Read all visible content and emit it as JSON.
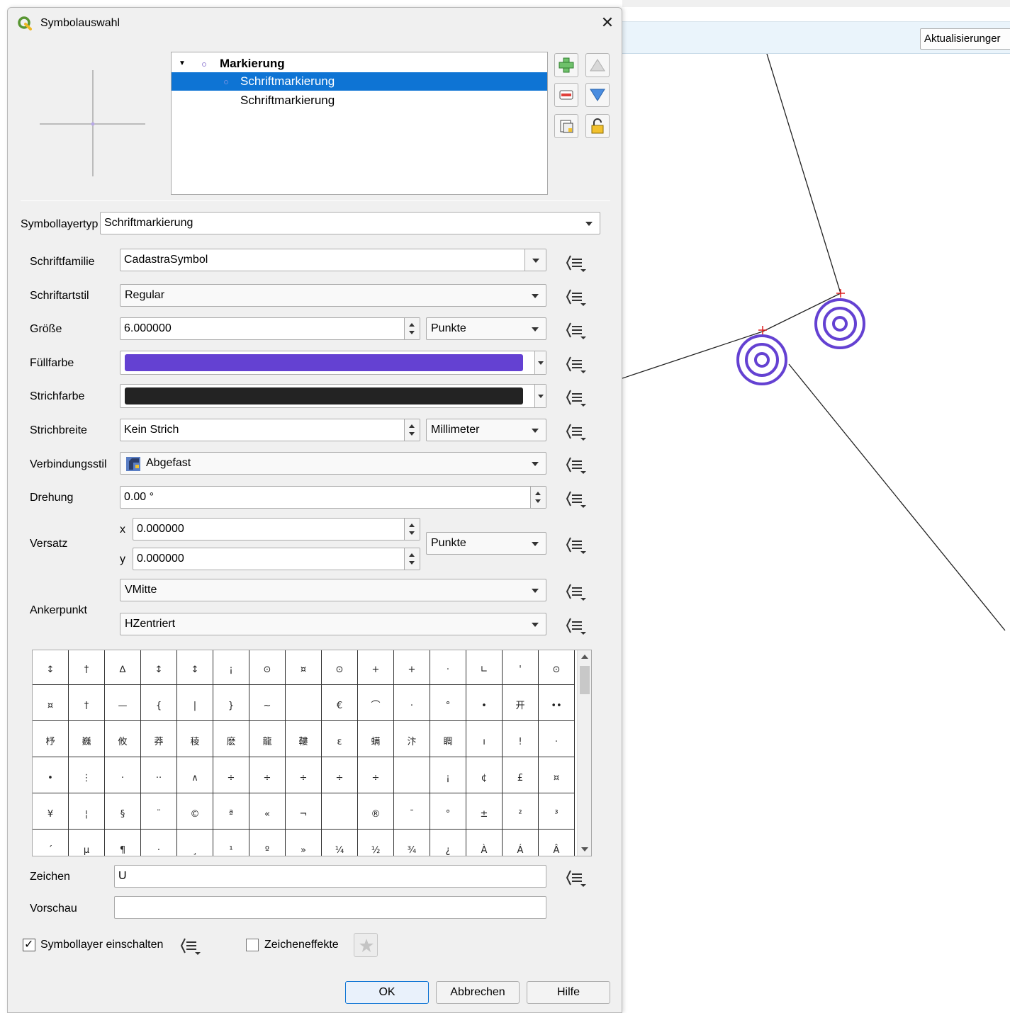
{
  "background": {
    "update_button_label": "Aktualisierunger"
  },
  "dialog": {
    "title": "Symbolauswahl",
    "close_glyph": "✕",
    "tree": {
      "root_label": "Markierung",
      "items": [
        "Schriftmarkierung",
        "Schriftmarkierung"
      ],
      "selected_index": 0
    },
    "symbol_layer_type": {
      "label": "Symbollayertyp",
      "value": "Schriftmarkierung"
    },
    "font_family": {
      "label": "Schriftfamilie",
      "value": "CadastraSymbol"
    },
    "font_style": {
      "label": "Schriftartstil",
      "value": "Regular"
    },
    "size": {
      "label": "Größe",
      "value": "6.000000",
      "unit": "Punkte"
    },
    "fill_color": {
      "label": "Füllfarbe",
      "color": "#6441d2"
    },
    "stroke_color": {
      "label": "Strichfarbe",
      "color": "#232323"
    },
    "stroke_width": {
      "label": "Strichbreite",
      "value": "Kein Strich",
      "unit": "Millimeter"
    },
    "join_style": {
      "label": "Verbindungsstil",
      "value": "Abgefast"
    },
    "rotation": {
      "label": "Drehung",
      "value": "0.00 °"
    },
    "offset": {
      "label": "Versatz",
      "x_label": "x",
      "x_value": "0.000000",
      "y_label": "y",
      "y_value": "0.000000",
      "unit": "Punkte"
    },
    "anchor": {
      "label": "Ankerpunkt",
      "vertical": "VMitte",
      "horizontal": "HZentriert"
    },
    "char_grid": {
      "rows": [
        [
          "↕",
          "†",
          "∆",
          "↕",
          "↕",
          "¡",
          "⊙",
          "¤",
          "⊙",
          "+",
          "+",
          "·",
          "∟",
          "'",
          "⊙"
        ],
        [
          "¤",
          "†",
          "—",
          "{",
          "|",
          "}",
          "~",
          "",
          "€",
          "⌒",
          "·",
          "°",
          "•",
          "开",
          "••"
        ],
        [
          "杼",
          "巍",
          "攸",
          "莽",
          "稜",
          "麽",
          "龍",
          "鞻",
          "ɛ",
          "螨",
          "汴",
          "睭",
          "ı",
          "ǃ",
          "·"
        ],
        [
          "•",
          "⋮",
          "·",
          "··",
          "∧",
          "÷",
          "÷",
          "÷",
          "÷",
          "÷",
          "",
          "¡",
          "¢",
          "£",
          "¤"
        ],
        [
          "¥",
          "¦",
          "§",
          "¨",
          "©",
          "ª",
          "«",
          "¬",
          "",
          "®",
          "¯",
          "°",
          "±",
          "²",
          "³"
        ],
        [
          "´",
          "µ",
          "¶",
          "·",
          "¸",
          "¹",
          "º",
          "»",
          "¼",
          "½",
          "¾",
          "¿",
          "À",
          "Á",
          "Â"
        ]
      ]
    },
    "character": {
      "label": "Zeichen",
      "value": "U"
    },
    "preview": {
      "label": "Vorschau",
      "value": ""
    },
    "enable_layer": {
      "label": "Symbollayer einschalten",
      "checked": true,
      "check_glyph": "✓"
    },
    "draw_effects": {
      "label": "Zeicheneffekte",
      "checked": false
    },
    "buttons": {
      "ok": "OK",
      "cancel": "Abbrechen",
      "help": "Hilfe"
    }
  }
}
